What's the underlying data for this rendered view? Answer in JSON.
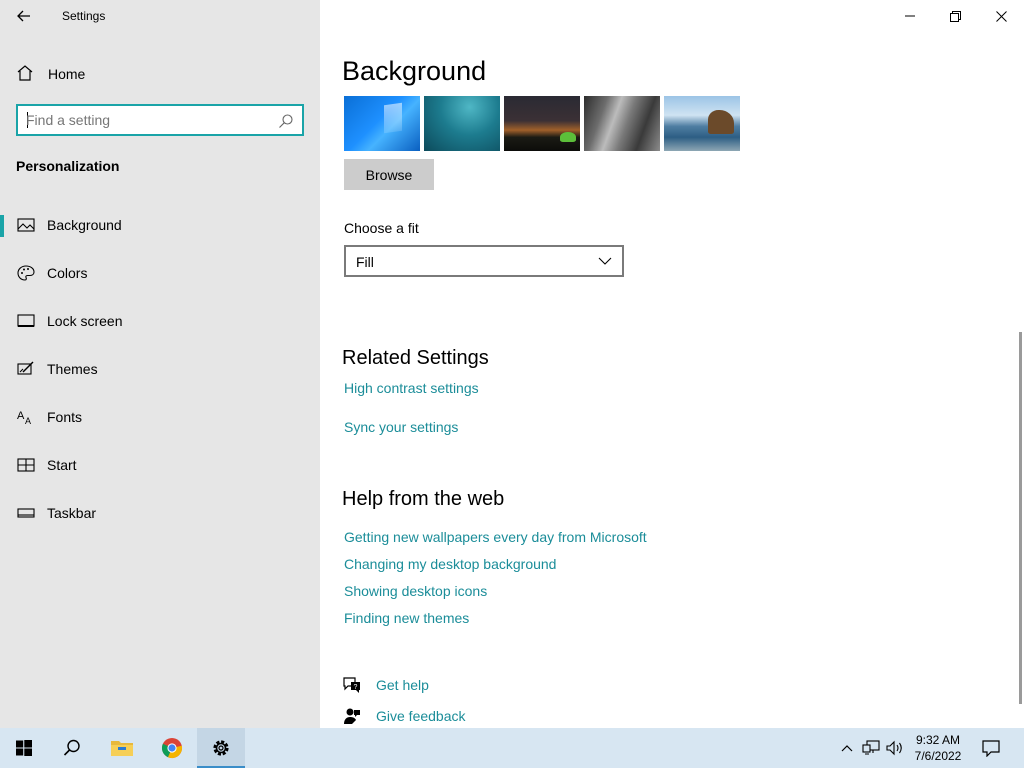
{
  "window": {
    "title": "Settings"
  },
  "nav": {
    "home_label": "Home",
    "search_placeholder": "Find a setting",
    "section_title": "Personalization",
    "items": [
      {
        "label": "Background",
        "icon": "picture-icon",
        "active": true
      },
      {
        "label": "Colors",
        "icon": "palette-icon",
        "active": false
      },
      {
        "label": "Lock screen",
        "icon": "lock-screen-icon",
        "active": false
      },
      {
        "label": "Themes",
        "icon": "themes-icon",
        "active": false
      },
      {
        "label": "Fonts",
        "icon": "fonts-icon",
        "active": false
      },
      {
        "label": "Start",
        "icon": "start-icon",
        "active": false
      },
      {
        "label": "Taskbar",
        "icon": "taskbar-icon",
        "active": false
      }
    ]
  },
  "content": {
    "page_title": "Background",
    "browse_label": "Browse",
    "fit_label": "Choose a fit",
    "fit_value": "Fill",
    "related_title": "Related Settings",
    "related_links": [
      "High contrast settings",
      "Sync your settings"
    ],
    "help_title": "Help from the web",
    "help_links": [
      "Getting new wallpapers every day from Microsoft",
      "Changing my desktop background",
      "Showing desktop icons",
      "Finding new themes"
    ],
    "get_help_label": "Get help",
    "give_feedback_label": "Give feedback"
  },
  "taskbar": {
    "apps": [
      "windows-start-icon",
      "search-icon",
      "file-explorer-icon",
      "chrome-icon",
      "settings-gear-icon"
    ],
    "time": "9:32 AM",
    "date": "7/6/2022"
  },
  "colors": {
    "accent": "#1aa4a8",
    "link": "#1b8d99",
    "nav_bg": "#e6e6e6",
    "taskbar_bg": "#d7e6f2"
  }
}
